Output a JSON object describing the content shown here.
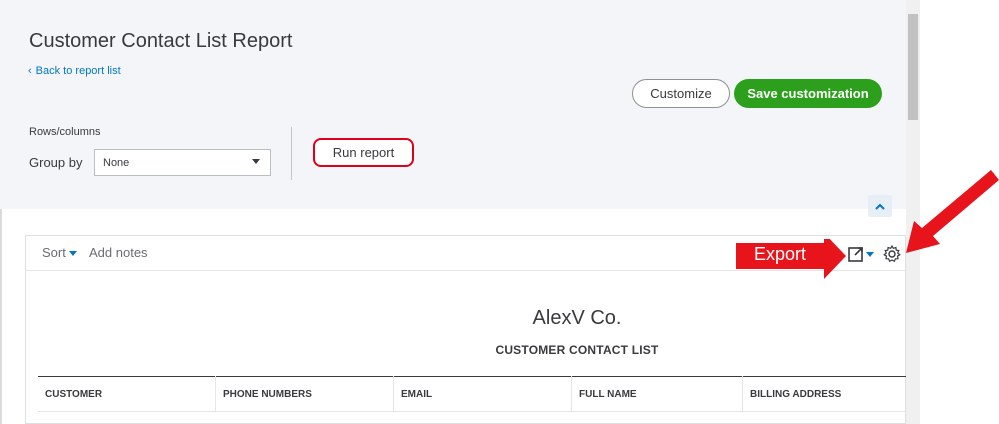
{
  "header": {
    "title": "Customer Contact List Report",
    "back_link": "Back to report list",
    "customize_label": "Customize",
    "save_label": "Save customization"
  },
  "controls": {
    "rows_columns_label": "Rows/columns",
    "group_by_label": "Group by",
    "group_by_value": "None",
    "run_report_label": "Run report"
  },
  "toolbar": {
    "sort_label": "Sort",
    "add_notes_label": "Add notes"
  },
  "report": {
    "company": "AlexV Co.",
    "title": "CUSTOMER CONTACT LIST",
    "columns": [
      "CUSTOMER",
      "PHONE NUMBERS",
      "EMAIL",
      "FULL NAME",
      "BILLING ADDRESS"
    ]
  },
  "annotations": {
    "export_label": "Export",
    "gear_label": "Gear",
    "arrow_color": "#e8141c",
    "highlight_color": "#e0001b"
  },
  "colors": {
    "primary_green": "#2ca01c",
    "link_blue": "#0077c5",
    "panel_bg": "#f4f5f8"
  },
  "icons": {
    "export": "export-icon",
    "gear": "gear-icon",
    "collapse": "chevron-up-icon",
    "back": "chevron-left-icon"
  }
}
